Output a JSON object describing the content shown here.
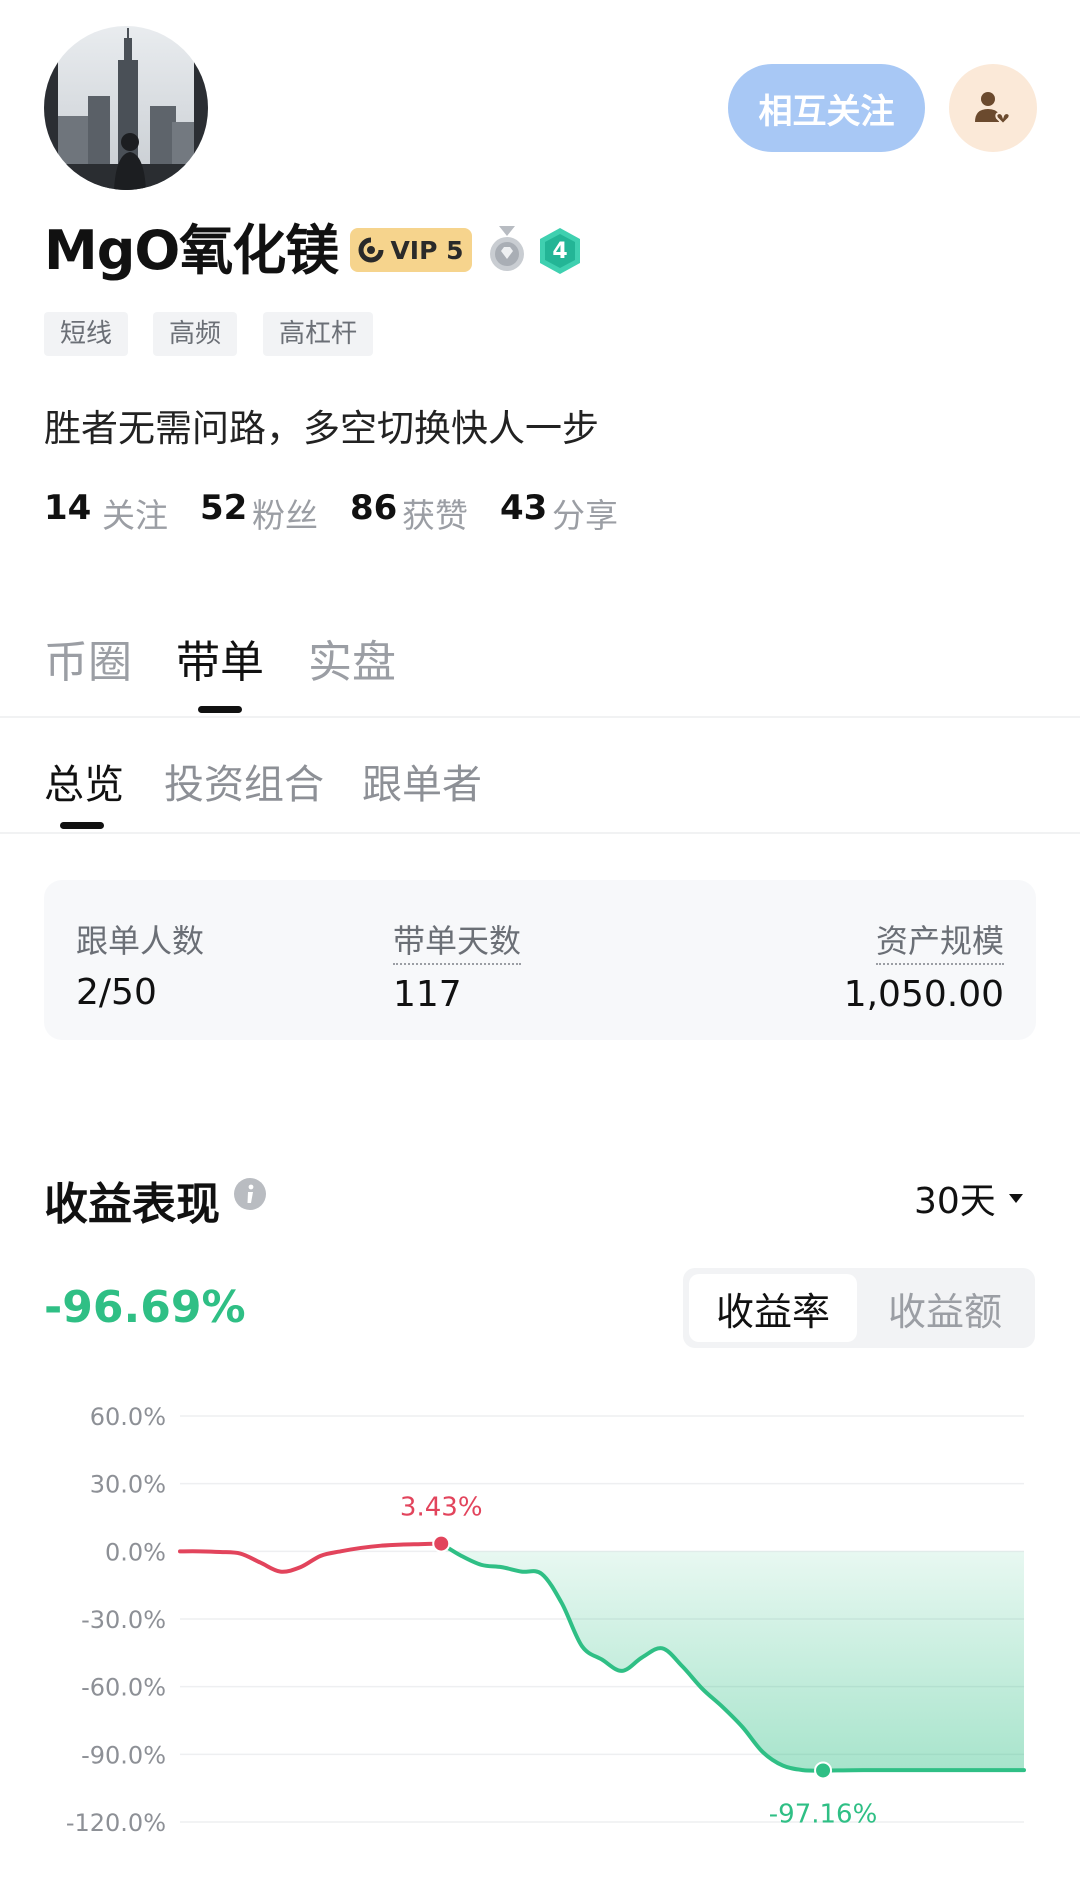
{
  "profile": {
    "name": "MgO氧化镁",
    "vip_label": "VIP 5",
    "level": "4",
    "tags": [
      "短线",
      "高频",
      "高杠杆"
    ],
    "bio": "胜者无需问路，多空切换快人一步",
    "follow_button": "相互关注",
    "stats": [
      {
        "value": "14",
        "label": "关注"
      },
      {
        "value": "52",
        "label": "粉丝"
      },
      {
        "value": "86",
        "label": "获赞"
      },
      {
        "value": "43",
        "label": "分享"
      }
    ]
  },
  "tabs": {
    "main": [
      "币圈",
      "带单",
      "实盘"
    ],
    "main_active": 1,
    "sub": [
      "总览",
      "投资组合",
      "跟单者"
    ],
    "sub_active": 0
  },
  "overview": {
    "followers_label": "跟单人数",
    "followers_value": "2/50",
    "days_label": "带单天数",
    "days_value": "117",
    "aum_label": "资产规模",
    "aum_value": "1,050.00"
  },
  "performance": {
    "title": "收益表现",
    "period": "30天",
    "return_value": "-96.69%",
    "toggle": [
      "收益率",
      "收益额"
    ],
    "toggle_active": 0
  },
  "colors": {
    "follow_button_bg": "#a8c8f5",
    "contact_button_bg": "#fbe9d8",
    "positive_red": "#e2445c",
    "negative_green": "#2fbf85"
  },
  "chart_data": {
    "type": "line",
    "ylim": [
      -120,
      60
    ],
    "yticks": [
      "60.0%",
      "30.0%",
      "0.0%",
      "-30.0%",
      "-60.0%",
      "-90.0%",
      "-120.0%"
    ],
    "grid": true,
    "series": [
      {
        "values": [
          0,
          0,
          -0.3,
          -1,
          -5,
          -9,
          -7,
          -2,
          0,
          1.5,
          2.5,
          3,
          3.2,
          3.43,
          -2,
          -6,
          -7,
          -9,
          -10,
          -23,
          -42,
          -48,
          -53,
          -47,
          -43,
          -51,
          -61,
          -69,
          -78,
          -89,
          -95,
          -97,
          -97.16,
          -97.1,
          -97,
          -97,
          -97,
          -97,
          -97,
          -97,
          -97,
          -97,
          -97
        ]
      }
    ],
    "annotations": [
      {
        "label": "3.43%",
        "index": 13,
        "value": 3.43
      },
      {
        "label": "-97.16%",
        "index": 32,
        "value": -97.16
      }
    ]
  }
}
